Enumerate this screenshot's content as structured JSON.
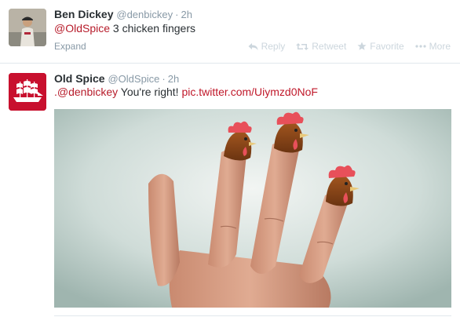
{
  "tweets": [
    {
      "fullname": "Ben Dickey",
      "username": "@denbickey",
      "time": "2h",
      "mention": "@OldSpice",
      "text": " 3 chicken fingers",
      "expand": "Expand",
      "actions": {
        "reply": "Reply",
        "retweet": "Retweet",
        "favorite": "Favorite",
        "more": "More"
      }
    },
    {
      "fullname": "Old Spice",
      "username": "@OldSpice",
      "time": "2h",
      "mention": ".@denbickey",
      "text": " You're right! ",
      "link": "pic.twitter.com/Uiymzd0NoF"
    }
  ],
  "colors": {
    "accent": "#c0182a",
    "muted": "#8899a6",
    "old_spice_red": "#c8102e"
  },
  "icons": [
    "reply-icon",
    "retweet-icon",
    "favorite-star-icon",
    "more-dots-icon",
    "ship-logo-icon"
  ]
}
